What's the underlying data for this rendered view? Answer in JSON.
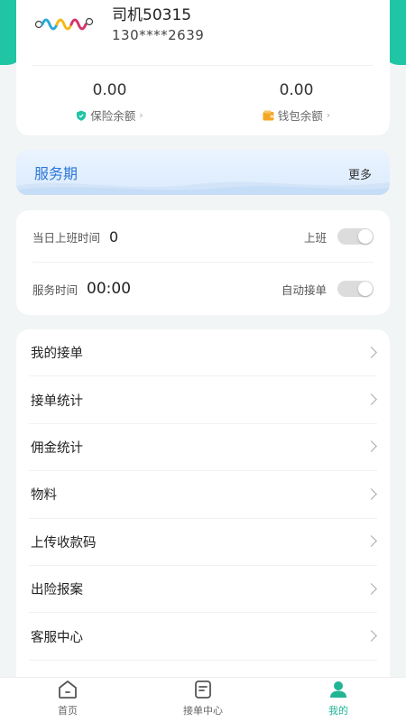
{
  "profile": {
    "driver_name": "司机50315",
    "phone": "130****2639",
    "insurance_balance": {
      "value": "0.00",
      "label": "保险余额",
      "chevron": "›"
    },
    "wallet_balance": {
      "value": "0.00",
      "label": "钱包余额",
      "chevron": "›"
    }
  },
  "service_banner": {
    "title": "服务期",
    "more_label": "更多"
  },
  "work_status": {
    "day_on_duty_label": "当日上班时间",
    "day_on_duty_value": "0",
    "on_duty_toggle_label": "上班",
    "service_time_label": "服务时间",
    "service_time_value": "00:00",
    "auto_accept_label": "自动接单"
  },
  "menu": {
    "items": [
      {
        "label": "我的接单"
      },
      {
        "label": "接单统计"
      },
      {
        "label": "佣金统计"
      },
      {
        "label": "物料"
      },
      {
        "label": "上传收款码"
      },
      {
        "label": "出险报案"
      },
      {
        "label": "客服中心"
      }
    ]
  },
  "tabbar": {
    "tabs": [
      {
        "label": "首页",
        "icon": "home-icon",
        "active": false
      },
      {
        "label": "接单中心",
        "icon": "order-center-icon",
        "active": false
      },
      {
        "label": "我的",
        "icon": "profile-icon",
        "active": true
      }
    ]
  },
  "colors": {
    "accent": "#1fc5a4",
    "service_title": "#2c77d6",
    "shield_icon": "#1fc5a4",
    "wallet_icon": "#f5a623"
  }
}
